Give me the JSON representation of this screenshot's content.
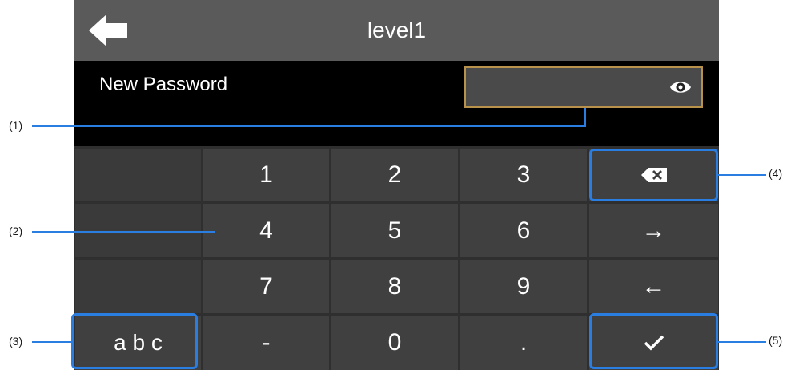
{
  "header": {
    "title": "level1",
    "back_icon": "arrow-left-icon"
  },
  "password": {
    "label": "New Password",
    "value": "",
    "eye_icon": "eye-icon"
  },
  "keys": {
    "k1": "1",
    "k2": "2",
    "k3": "3",
    "k4": "4",
    "k5": "5",
    "k6": "6",
    "k7": "7",
    "k8": "8",
    "k9": "9",
    "dash": "-",
    "zero": "0",
    "dot": ".",
    "abc": "a b c",
    "right": "→",
    "left": "←",
    "backspace_icon": "backspace-icon",
    "confirm_icon": "checkmark-icon"
  },
  "callouts": {
    "c1": "(1)",
    "c2": "(2)",
    "c3": "(3)",
    "c4": "(4)",
    "c5": "(5)"
  },
  "colors": {
    "highlight": "#2a7de1",
    "field_border": "#b8914a",
    "titlebar": "#5a5a5a"
  }
}
